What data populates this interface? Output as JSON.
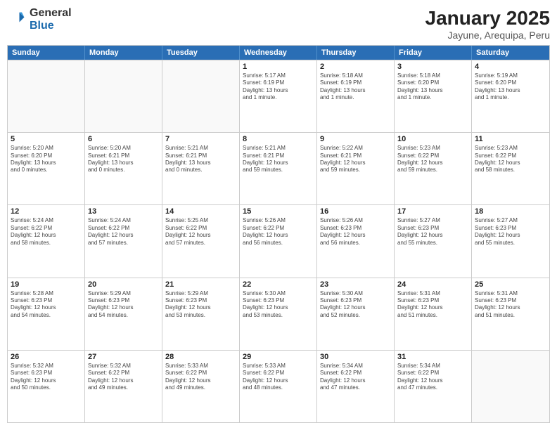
{
  "header": {
    "logo_general": "General",
    "logo_blue": "Blue",
    "month_title": "January 2025",
    "location": "Jayune, Arequipa, Peru"
  },
  "days_of_week": [
    "Sunday",
    "Monday",
    "Tuesday",
    "Wednesday",
    "Thursday",
    "Friday",
    "Saturday"
  ],
  "rows": [
    [
      {
        "day": "",
        "info": []
      },
      {
        "day": "",
        "info": []
      },
      {
        "day": "",
        "info": []
      },
      {
        "day": "1",
        "info": [
          "Sunrise: 5:17 AM",
          "Sunset: 6:19 PM",
          "Daylight: 13 hours",
          "and 1 minute."
        ]
      },
      {
        "day": "2",
        "info": [
          "Sunrise: 5:18 AM",
          "Sunset: 6:19 PM",
          "Daylight: 13 hours",
          "and 1 minute."
        ]
      },
      {
        "day": "3",
        "info": [
          "Sunrise: 5:18 AM",
          "Sunset: 6:20 PM",
          "Daylight: 13 hours",
          "and 1 minute."
        ]
      },
      {
        "day": "4",
        "info": [
          "Sunrise: 5:19 AM",
          "Sunset: 6:20 PM",
          "Daylight: 13 hours",
          "and 1 minute."
        ]
      }
    ],
    [
      {
        "day": "5",
        "info": [
          "Sunrise: 5:20 AM",
          "Sunset: 6:20 PM",
          "Daylight: 13 hours",
          "and 0 minutes."
        ]
      },
      {
        "day": "6",
        "info": [
          "Sunrise: 5:20 AM",
          "Sunset: 6:21 PM",
          "Daylight: 13 hours",
          "and 0 minutes."
        ]
      },
      {
        "day": "7",
        "info": [
          "Sunrise: 5:21 AM",
          "Sunset: 6:21 PM",
          "Daylight: 13 hours",
          "and 0 minutes."
        ]
      },
      {
        "day": "8",
        "info": [
          "Sunrise: 5:21 AM",
          "Sunset: 6:21 PM",
          "Daylight: 12 hours",
          "and 59 minutes."
        ]
      },
      {
        "day": "9",
        "info": [
          "Sunrise: 5:22 AM",
          "Sunset: 6:21 PM",
          "Daylight: 12 hours",
          "and 59 minutes."
        ]
      },
      {
        "day": "10",
        "info": [
          "Sunrise: 5:23 AM",
          "Sunset: 6:22 PM",
          "Daylight: 12 hours",
          "and 59 minutes."
        ]
      },
      {
        "day": "11",
        "info": [
          "Sunrise: 5:23 AM",
          "Sunset: 6:22 PM",
          "Daylight: 12 hours",
          "and 58 minutes."
        ]
      }
    ],
    [
      {
        "day": "12",
        "info": [
          "Sunrise: 5:24 AM",
          "Sunset: 6:22 PM",
          "Daylight: 12 hours",
          "and 58 minutes."
        ]
      },
      {
        "day": "13",
        "info": [
          "Sunrise: 5:24 AM",
          "Sunset: 6:22 PM",
          "Daylight: 12 hours",
          "and 57 minutes."
        ]
      },
      {
        "day": "14",
        "info": [
          "Sunrise: 5:25 AM",
          "Sunset: 6:22 PM",
          "Daylight: 12 hours",
          "and 57 minutes."
        ]
      },
      {
        "day": "15",
        "info": [
          "Sunrise: 5:26 AM",
          "Sunset: 6:22 PM",
          "Daylight: 12 hours",
          "and 56 minutes."
        ]
      },
      {
        "day": "16",
        "info": [
          "Sunrise: 5:26 AM",
          "Sunset: 6:23 PM",
          "Daylight: 12 hours",
          "and 56 minutes."
        ]
      },
      {
        "day": "17",
        "info": [
          "Sunrise: 5:27 AM",
          "Sunset: 6:23 PM",
          "Daylight: 12 hours",
          "and 55 minutes."
        ]
      },
      {
        "day": "18",
        "info": [
          "Sunrise: 5:27 AM",
          "Sunset: 6:23 PM",
          "Daylight: 12 hours",
          "and 55 minutes."
        ]
      }
    ],
    [
      {
        "day": "19",
        "info": [
          "Sunrise: 5:28 AM",
          "Sunset: 6:23 PM",
          "Daylight: 12 hours",
          "and 54 minutes."
        ]
      },
      {
        "day": "20",
        "info": [
          "Sunrise: 5:29 AM",
          "Sunset: 6:23 PM",
          "Daylight: 12 hours",
          "and 54 minutes."
        ]
      },
      {
        "day": "21",
        "info": [
          "Sunrise: 5:29 AM",
          "Sunset: 6:23 PM",
          "Daylight: 12 hours",
          "and 53 minutes."
        ]
      },
      {
        "day": "22",
        "info": [
          "Sunrise: 5:30 AM",
          "Sunset: 6:23 PM",
          "Daylight: 12 hours",
          "and 53 minutes."
        ]
      },
      {
        "day": "23",
        "info": [
          "Sunrise: 5:30 AM",
          "Sunset: 6:23 PM",
          "Daylight: 12 hours",
          "and 52 minutes."
        ]
      },
      {
        "day": "24",
        "info": [
          "Sunrise: 5:31 AM",
          "Sunset: 6:23 PM",
          "Daylight: 12 hours",
          "and 51 minutes."
        ]
      },
      {
        "day": "25",
        "info": [
          "Sunrise: 5:31 AM",
          "Sunset: 6:23 PM",
          "Daylight: 12 hours",
          "and 51 minutes."
        ]
      }
    ],
    [
      {
        "day": "26",
        "info": [
          "Sunrise: 5:32 AM",
          "Sunset: 6:23 PM",
          "Daylight: 12 hours",
          "and 50 minutes."
        ]
      },
      {
        "day": "27",
        "info": [
          "Sunrise: 5:32 AM",
          "Sunset: 6:22 PM",
          "Daylight: 12 hours",
          "and 49 minutes."
        ]
      },
      {
        "day": "28",
        "info": [
          "Sunrise: 5:33 AM",
          "Sunset: 6:22 PM",
          "Daylight: 12 hours",
          "and 49 minutes."
        ]
      },
      {
        "day": "29",
        "info": [
          "Sunrise: 5:33 AM",
          "Sunset: 6:22 PM",
          "Daylight: 12 hours",
          "and 48 minutes."
        ]
      },
      {
        "day": "30",
        "info": [
          "Sunrise: 5:34 AM",
          "Sunset: 6:22 PM",
          "Daylight: 12 hours",
          "and 47 minutes."
        ]
      },
      {
        "day": "31",
        "info": [
          "Sunrise: 5:34 AM",
          "Sunset: 6:22 PM",
          "Daylight: 12 hours",
          "and 47 minutes."
        ]
      },
      {
        "day": "",
        "info": []
      }
    ]
  ]
}
